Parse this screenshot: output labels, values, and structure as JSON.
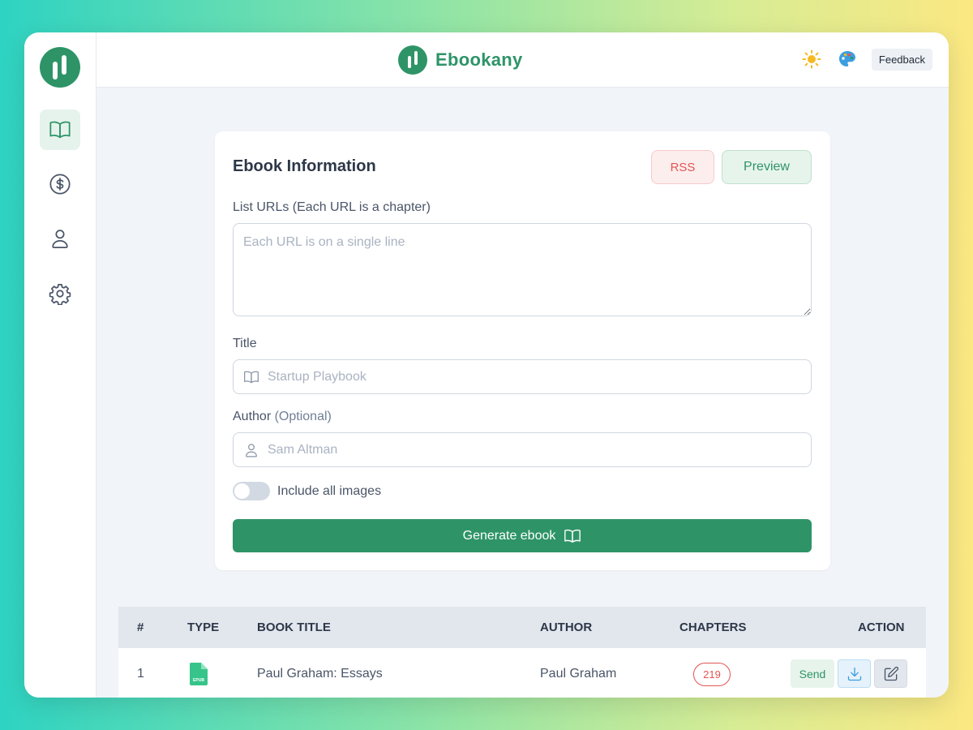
{
  "app": {
    "name": "Ebookany"
  },
  "topbar": {
    "feedback_label": "Feedback"
  },
  "sidebar": {
    "items": [
      {
        "name": "library",
        "icon": "book-open-icon",
        "active": true
      },
      {
        "name": "pricing",
        "icon": "dollar-circle-icon",
        "active": false
      },
      {
        "name": "account",
        "icon": "user-icon",
        "active": false
      },
      {
        "name": "settings",
        "icon": "gear-icon",
        "active": false
      }
    ]
  },
  "form": {
    "title": "Ebook Information",
    "rss_label": "RSS",
    "preview_label": "Preview",
    "urls_label": "List URLs (Each URL is a chapter)",
    "urls_placeholder": "Each URL is on a single line",
    "title_label": "Title",
    "title_placeholder": "Startup Playbook",
    "author_label": "Author",
    "author_optional": "(Optional)",
    "author_placeholder": "Sam Altman",
    "images_toggle_label": "Include all images",
    "images_toggle_on": false,
    "generate_label": "Generate ebook"
  },
  "table": {
    "headers": {
      "num": "#",
      "type": "TYPE",
      "title": "BOOK TITLE",
      "author": "AUTHOR",
      "chapters": "CHAPTERS",
      "action": "ACTION"
    },
    "rows": [
      {
        "num": "1",
        "type": "EPUB",
        "title": "Paul Graham: Essays",
        "author": "Paul Graham",
        "chapters": "219",
        "send_label": "Send"
      }
    ]
  },
  "colors": {
    "brand": "#2e9467",
    "danger": "#e25555",
    "info": "#3b9ee0"
  }
}
